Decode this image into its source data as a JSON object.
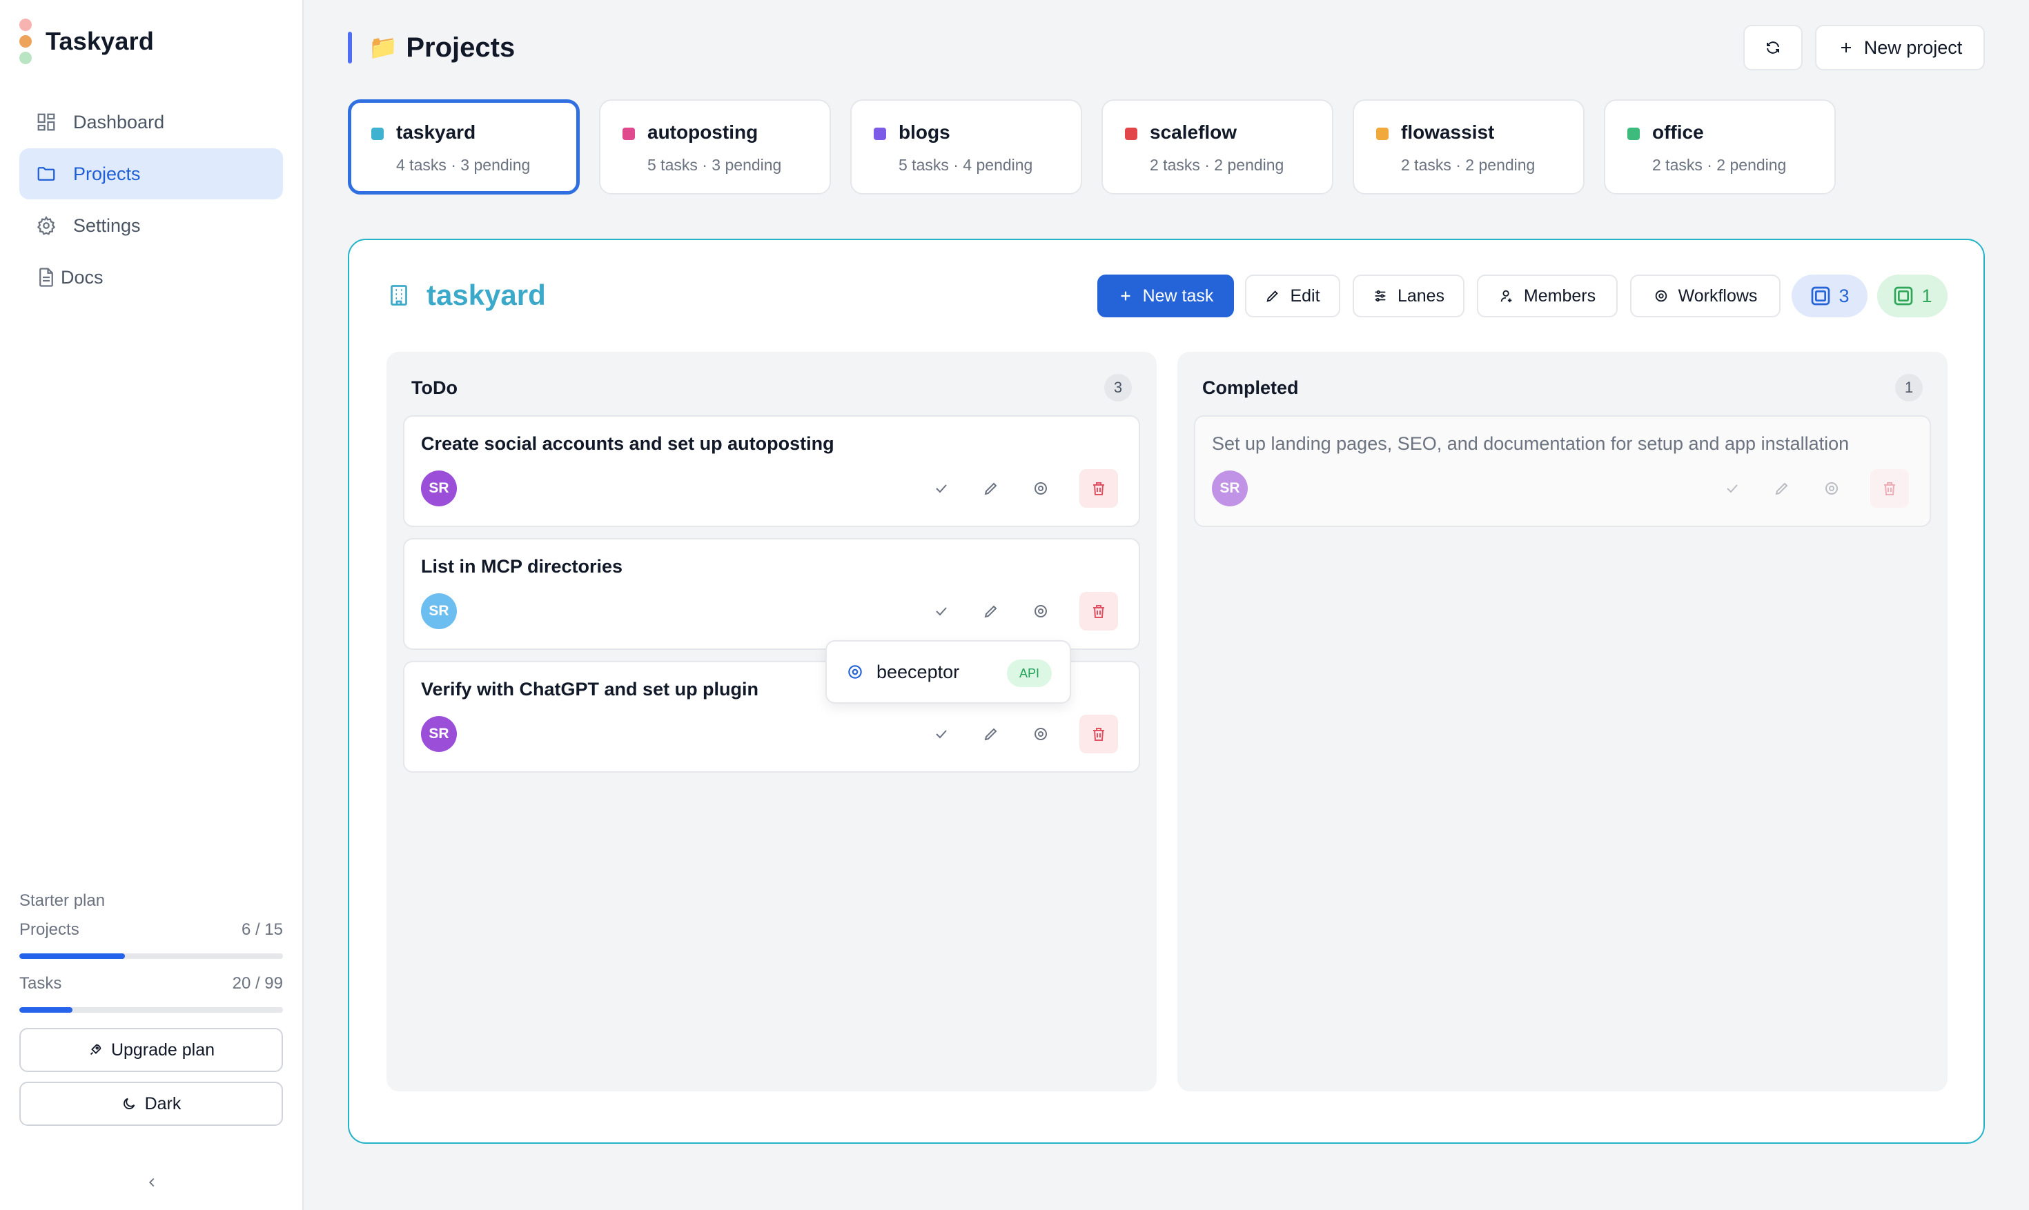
{
  "app": {
    "name": "Taskyard"
  },
  "colors": {
    "accent": "#2463d8",
    "board_border": "#22b3c9",
    "board_title": "#3ba9c9"
  },
  "sidebar": {
    "items": [
      {
        "label": "Dashboard",
        "icon": "dashboard-icon",
        "active": false
      },
      {
        "label": "Projects",
        "icon": "folder-icon",
        "active": true
      },
      {
        "label": "Settings",
        "icon": "gear-icon",
        "active": false
      },
      {
        "label": "Docs",
        "icon": "document-icon",
        "active": false
      }
    ],
    "plan": {
      "title": "Starter plan",
      "projects": {
        "label": "Projects",
        "value": "6 / 15",
        "used": 6,
        "limit": 15
      },
      "tasks": {
        "label": "Tasks",
        "value": "20 / 99",
        "used": 20,
        "limit": 99
      }
    },
    "upgrade_label": "Upgrade plan",
    "theme_label": "Dark",
    "collapse_icon": "chevron-left-icon"
  },
  "header": {
    "title": "Projects",
    "title_emoji": "📁",
    "refresh_icon": "refresh-icon",
    "new_project_label": "New project"
  },
  "projects": [
    {
      "name": "taskyard",
      "meta": "4 tasks · 3 pending",
      "color": "#3fb2cf",
      "selected": true
    },
    {
      "name": "autoposting",
      "meta": "5 tasks · 3 pending",
      "color": "#e0498e",
      "selected": false
    },
    {
      "name": "blogs",
      "meta": "5 tasks · 4 pending",
      "color": "#7c5ce6",
      "selected": false
    },
    {
      "name": "scaleflow",
      "meta": "2 tasks · 2 pending",
      "color": "#e2464a",
      "selected": false
    },
    {
      "name": "flowassist",
      "meta": "2 tasks · 2 pending",
      "color": "#f0a93a",
      "selected": false
    },
    {
      "name": "office",
      "meta": "2 tasks · 2 pending",
      "color": "#3dbb7c",
      "selected": false
    }
  ],
  "board": {
    "name": "taskyard",
    "toolbar": {
      "new_task": "New task",
      "edit": "Edit",
      "lanes": "Lanes",
      "members": "Members",
      "workflows": "Workflows",
      "open_count": "3",
      "done_count": "1"
    },
    "lanes": [
      {
        "title": "ToDo",
        "count": "3",
        "tasks": [
          {
            "title": "Create social accounts and set up autoposting",
            "assignee": "SR",
            "avatar_color": "#9b4fd9"
          },
          {
            "title": "List in MCP directories",
            "assignee": "SR",
            "avatar_color": "#6cbdf0"
          },
          {
            "title": "Verify with ChatGPT and set up plugin",
            "assignee": "SR",
            "avatar_color": "#9b4fd9"
          }
        ]
      },
      {
        "title": "Completed",
        "count": "1",
        "tasks": [
          {
            "title": "Set up landing pages, SEO, and documentation for setup and app installation",
            "assignee": "SR",
            "avatar_color": "#9b4fd9"
          }
        ]
      }
    ],
    "workflow_popup": {
      "label": "beeceptor",
      "badge": "API"
    }
  }
}
